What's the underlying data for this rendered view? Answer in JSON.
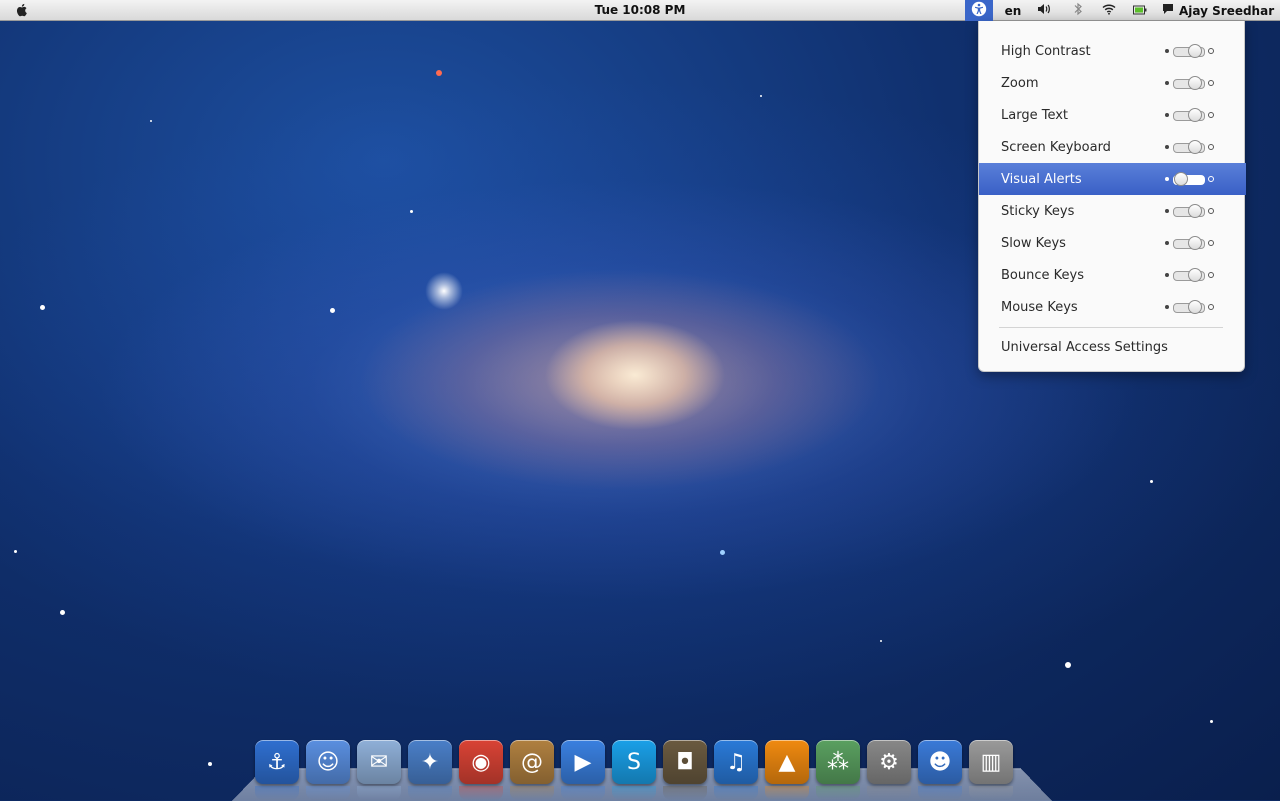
{
  "menubar": {
    "clock": "Tue 10:08 PM",
    "language": "en",
    "user_name": "Ajay Sreedhar",
    "icons": {
      "apple": "apple-icon",
      "universal_access": "universal-access-icon",
      "volume": "volume-icon",
      "bluetooth": "bluetooth-icon",
      "wifi": "wifi-icon",
      "battery": "battery-icon",
      "chat_status": "speech-bubble-icon"
    }
  },
  "accessibility_menu": {
    "items": [
      {
        "label": "High Contrast",
        "enabled": false
      },
      {
        "label": "Zoom",
        "enabled": false
      },
      {
        "label": "Large Text",
        "enabled": false
      },
      {
        "label": "Screen Keyboard",
        "enabled": false
      },
      {
        "label": "Visual Alerts",
        "enabled": false,
        "highlighted": true
      },
      {
        "label": "Sticky Keys",
        "enabled": false
      },
      {
        "label": "Slow Keys",
        "enabled": false
      },
      {
        "label": "Bounce Keys",
        "enabled": false
      },
      {
        "label": "Mouse Keys",
        "enabled": false
      }
    ],
    "settings_label": "Universal Access Settings"
  },
  "dock": {
    "apps": [
      {
        "name": "anchor-app-icon",
        "color": "#2f6fd0"
      },
      {
        "name": "finder-icon",
        "color": "#5a8fe0"
      },
      {
        "name": "mail-stamp-icon",
        "color": "#8fb0d8"
      },
      {
        "name": "safari-compass-icon",
        "color": "#4a7fc8"
      },
      {
        "name": "chrome-icon",
        "color": "#d94335"
      },
      {
        "name": "address-book-icon",
        "color": "#b08040"
      },
      {
        "name": "ichat-video-icon",
        "color": "#3a80e0"
      },
      {
        "name": "skype-icon",
        "color": "#1aa0e8"
      },
      {
        "name": "iphoto-icon",
        "color": "#6a5a40"
      },
      {
        "name": "itunes-icon",
        "color": "#2a7ad8"
      },
      {
        "name": "vlc-cone-icon",
        "color": "#f08a10"
      },
      {
        "name": "network-app-icon",
        "color": "#5aa060"
      },
      {
        "name": "system-preferences-icon",
        "color": "#888888"
      },
      {
        "name": "messages-icon",
        "color": "#3a7ad8"
      },
      {
        "name": "trash-icon",
        "color": "#9a9a9a"
      }
    ]
  }
}
